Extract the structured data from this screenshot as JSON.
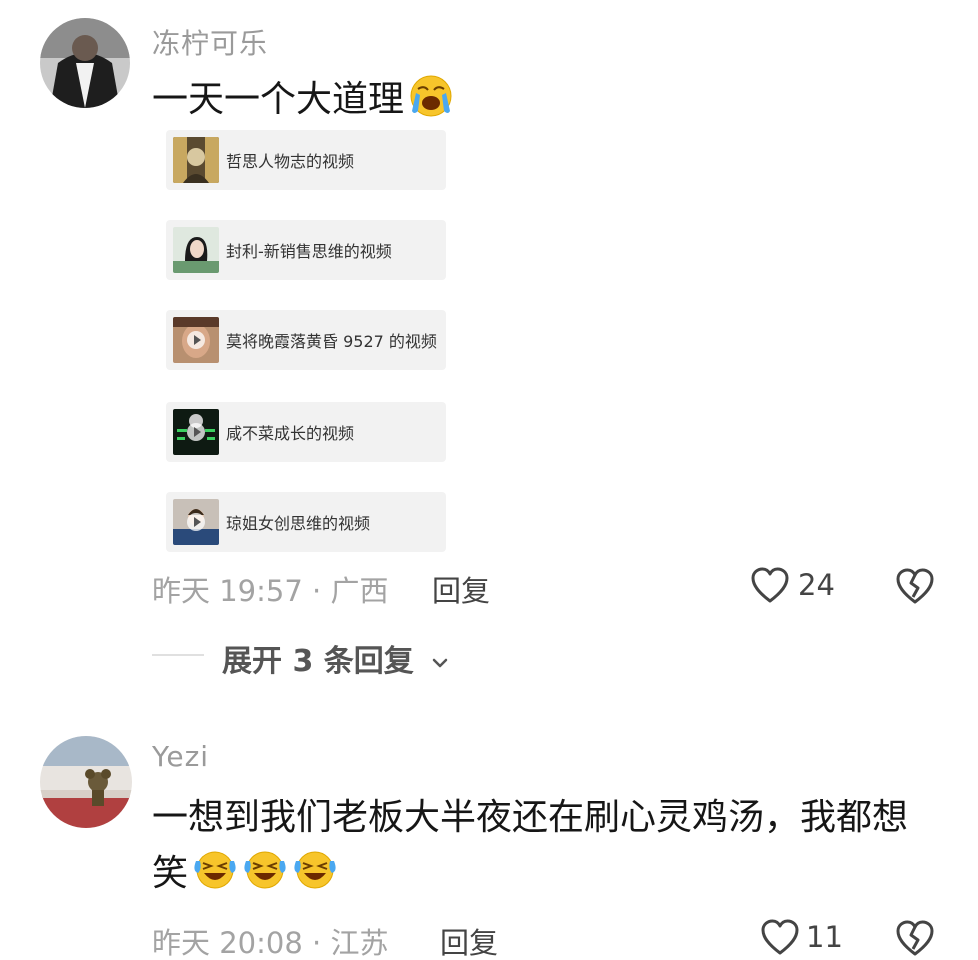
{
  "comments": [
    {
      "username": "冻柠可乐",
      "text": "一天一个大道理",
      "emoji_icon": "loudly-crying-face-icon",
      "videos": [
        {
          "title": "哲思人物志的视频",
          "thumb_icon": "portrait-thumbnail"
        },
        {
          "title": "封利-新销售思维的视频",
          "thumb_icon": "woman-portrait-thumbnail"
        },
        {
          "title": "莫将晚霞落黄昏 9527 的视频",
          "thumb_icon": "play-thumbnail"
        },
        {
          "title": "咸不菜成长的视频",
          "thumb_icon": "green-text-play-thumbnail"
        },
        {
          "title": "琼姐女创思维的视频",
          "thumb_icon": "office-play-thumbnail"
        }
      ],
      "time_location": "昨天 19:57 · 广西",
      "reply_label": "回复",
      "likes": "24",
      "expand_label": "展开 3 条回复"
    },
    {
      "username": "Yezi",
      "text_line1": "一想到我们老板大半夜还在刷心灵鸡汤，我都想",
      "text_line2": "笑",
      "emoji_icon": "laughing-crying-face-icon",
      "time_location": "昨天 20:08 · 江苏",
      "reply_label": "回复",
      "likes": "11"
    }
  ],
  "colors": {
    "meta_text": "#a3a3a3",
    "card_bg": "#f2f2f2",
    "emoji_yellow": "#f7c52b"
  }
}
